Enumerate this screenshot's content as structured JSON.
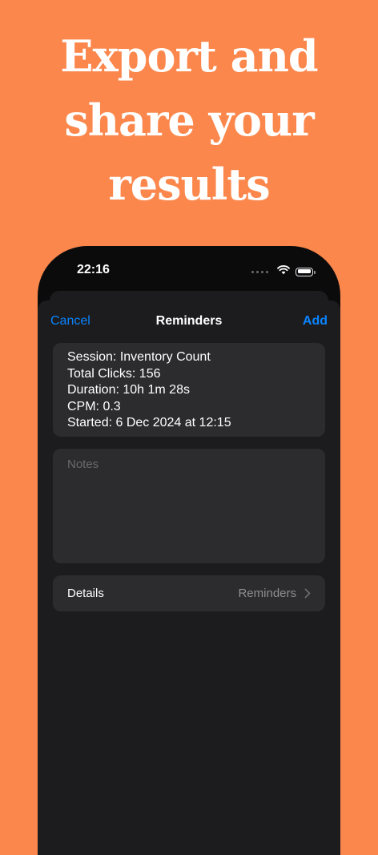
{
  "headline": {
    "line1": "Export and",
    "line2": "share your",
    "line3": "results"
  },
  "status_bar": {
    "time": "22:16",
    "icons": [
      "cellular-dots-icon",
      "wifi-icon",
      "battery-icon"
    ]
  },
  "nav": {
    "cancel_label": "Cancel",
    "title": "Reminders",
    "add_label": "Add"
  },
  "summary": {
    "session": "Session: Inventory Count",
    "total_clicks": "Total Clicks: 156",
    "duration": "Duration: 10h 1m 28s",
    "cpm": "CPM: 0.3",
    "started": "Started: 6 Dec 2024 at 12:15"
  },
  "notes": {
    "placeholder": "Notes",
    "value": ""
  },
  "details": {
    "label": "Details",
    "value": "Reminders",
    "icon": "chevron-right-icon"
  },
  "colors": {
    "background": "#FB874C",
    "accent": "#0A84FF",
    "sheet": "#1C1C1E",
    "card": "#2C2C2E"
  }
}
